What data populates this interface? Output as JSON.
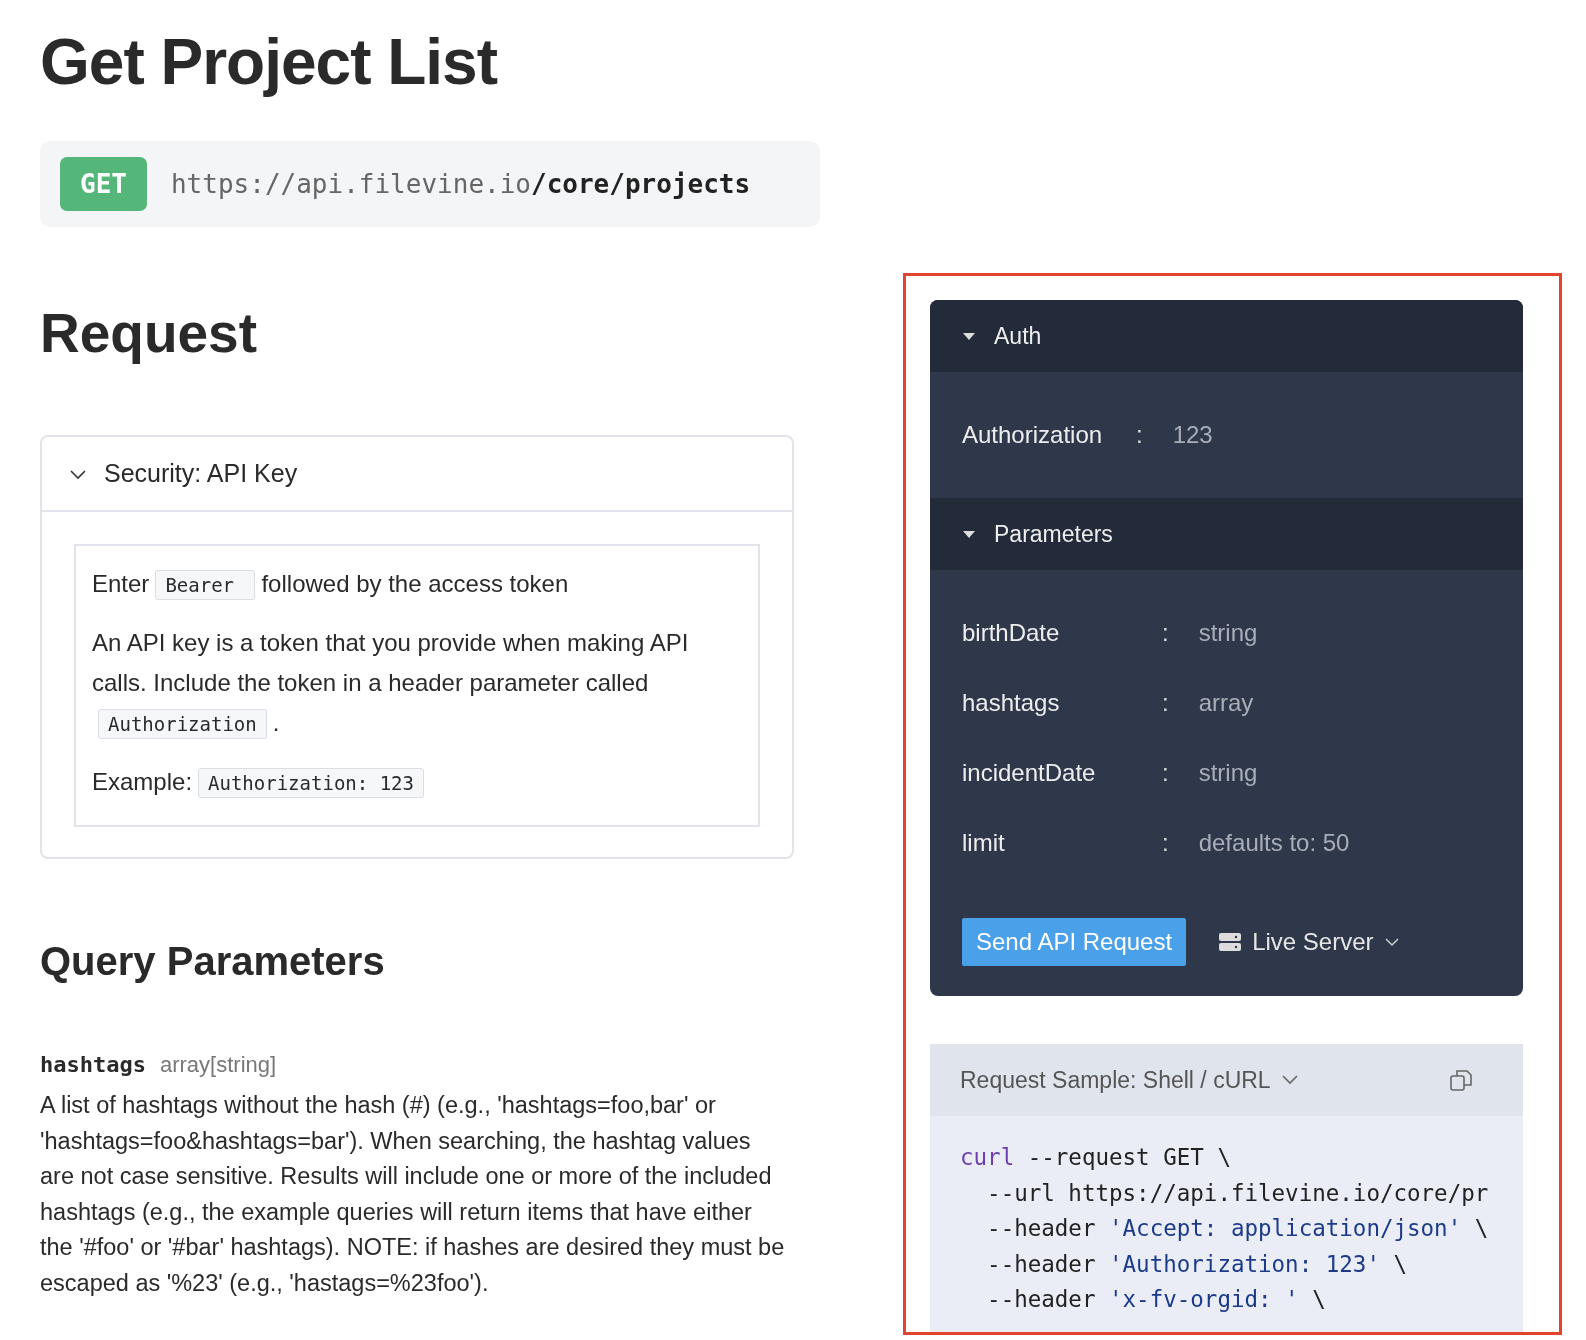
{
  "title": "Get Project List",
  "endpoint": {
    "method": "GET",
    "base_url": "https://api.filevine.io",
    "path": "/core/projects"
  },
  "request_heading": "Request",
  "security": {
    "title": "Security: API Key",
    "expanded": true,
    "paragraphs": [
      [
        {
          "kind": "text",
          "text": "Enter"
        },
        {
          "kind": "code",
          "text": "Bearer "
        },
        {
          "kind": "text",
          "text": "followed by the access token"
        }
      ],
      [
        {
          "kind": "text",
          "text": "An API key is a token that you provide when making API calls. Include the token in a header parameter called"
        },
        {
          "kind": "code",
          "text": "Authorization"
        },
        {
          "kind": "text",
          "text": "."
        }
      ],
      [
        {
          "kind": "text",
          "text": "Example:"
        },
        {
          "kind": "code",
          "text": "Authorization: 123"
        }
      ]
    ]
  },
  "query_heading": "Query Parameters",
  "param": {
    "name": "hashtags",
    "type": "array[string]",
    "description": "A list of hashtags without the hash (#) (e.g., 'hashtags=foo,bar' or 'hashtags=foo&hashtags=bar'). When searching, the hashtag values are not case sensitive. Results will include one or more of the included hashtags (e.g., the example queries will return items that have either the '#foo' or '#bar' hashtags). NOTE: if hashes are desired they must be escaped as '%23' (e.g., 'hastags=%23foo')."
  },
  "console": {
    "sections": [
      {
        "title": "Auth",
        "expanded": true,
        "rows": [
          {
            "name": "Authorization",
            "separator": ":",
            "value": "123"
          }
        ]
      },
      {
        "title": "Parameters",
        "expanded": true,
        "rows": [
          {
            "name": "birthDate",
            "separator": ":",
            "value": "string"
          },
          {
            "name": "hashtags",
            "separator": ":",
            "value": "array"
          },
          {
            "name": "incidentDate",
            "separator": ":",
            "value": "string"
          },
          {
            "name": "limit",
            "separator": ":",
            "value": "defaults to: 50"
          }
        ]
      }
    ],
    "send_button": "Send API Request",
    "server": "Live Server"
  },
  "sample": {
    "title": "Request Sample: Shell / cURL",
    "lines": [
      [
        {
          "kind": "keyword",
          "text": "curl"
        },
        {
          "kind": "plain",
          "text": " --request GET \\"
        }
      ],
      [
        {
          "kind": "plain",
          "text": "  --url https://api.filevine.io/core/pr"
        }
      ],
      [
        {
          "kind": "plain",
          "text": "  --header "
        },
        {
          "kind": "string",
          "text": "'Accept: application/json'"
        },
        {
          "kind": "plain",
          "text": " \\"
        }
      ],
      [
        {
          "kind": "plain",
          "text": "  --header "
        },
        {
          "kind": "string",
          "text": "'Authorization: 123'"
        },
        {
          "kind": "plain",
          "text": " \\"
        }
      ],
      [
        {
          "kind": "plain",
          "text": "  --header "
        },
        {
          "kind": "string",
          "text": "'x-fv-orgid: '"
        },
        {
          "kind": "plain",
          "text": " \\"
        }
      ]
    ]
  }
}
